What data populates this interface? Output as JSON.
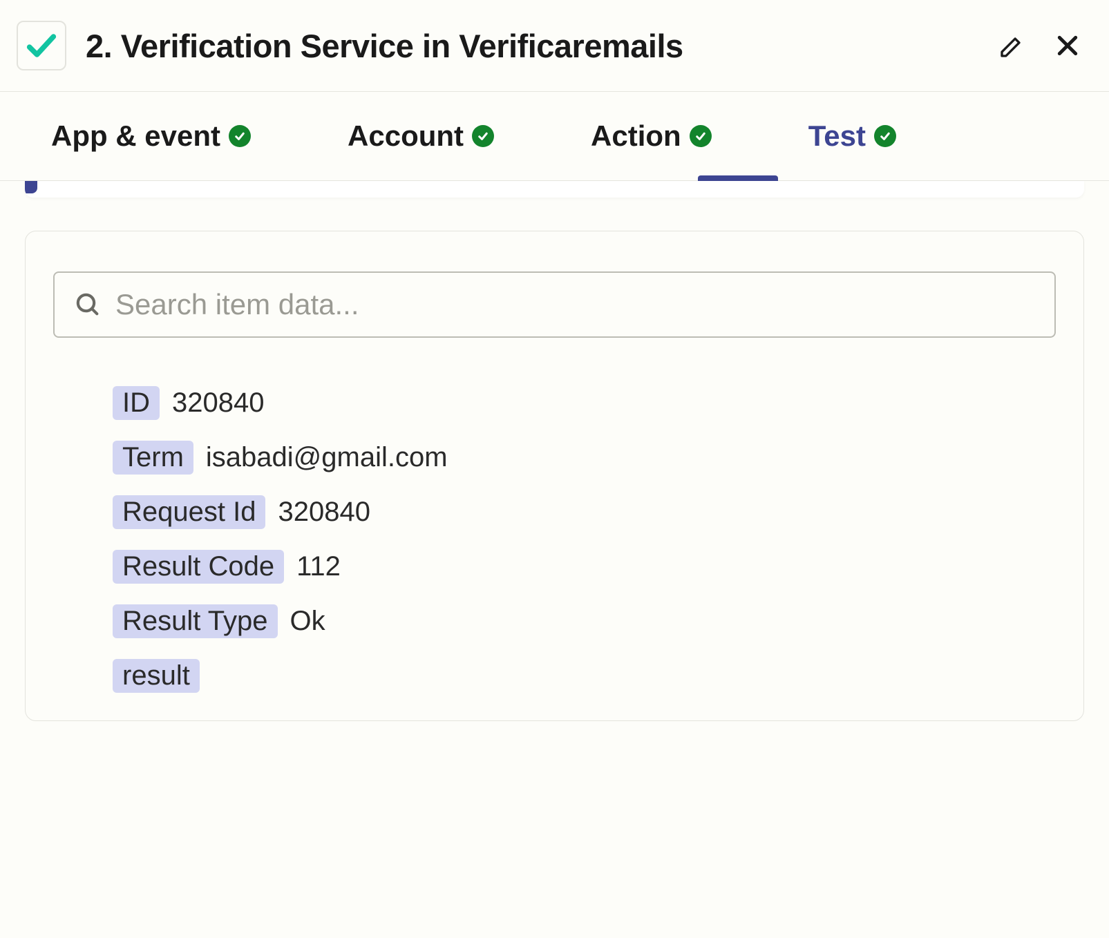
{
  "header": {
    "title": "2. Verification Service in Verificaremails"
  },
  "tabs": [
    {
      "label": "App & event",
      "active": false
    },
    {
      "label": "Account",
      "active": false
    },
    {
      "label": "Action",
      "active": false
    },
    {
      "label": "Test",
      "active": true
    }
  ],
  "search": {
    "placeholder": "Search item data..."
  },
  "results": [
    {
      "key": "ID",
      "value": "320840"
    },
    {
      "key": "Term",
      "value": "isabadi@gmail.com"
    },
    {
      "key": "Request Id",
      "value": "320840"
    },
    {
      "key": "Result Code",
      "value": "112"
    },
    {
      "key": "Result Type",
      "value": "Ok"
    },
    {
      "key": "result",
      "value": ""
    }
  ],
  "colors": {
    "accent": "#3d4592",
    "success": "#13842c",
    "check": "#12c4a1",
    "keyBg": "#d2d5f2"
  }
}
